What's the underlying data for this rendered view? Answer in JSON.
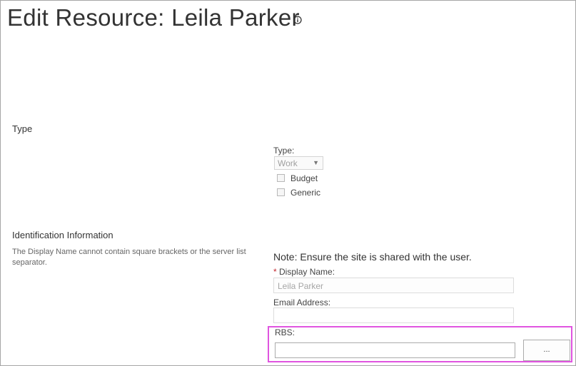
{
  "header": {
    "title": "Edit Resource: Leila Parker",
    "info_icon": "info-icon"
  },
  "sections": {
    "type": {
      "title": "Type",
      "type_label": "Type:",
      "type_value": "Work",
      "checkboxes": [
        {
          "label": "Budget",
          "checked": false
        },
        {
          "label": "Generic",
          "checked": false
        }
      ]
    },
    "identification": {
      "title": "Identification Information",
      "description": "The Display Name cannot contain square brackets or the server list separator.",
      "note": "Note: Ensure the site is shared with the user.",
      "required_marker": "*",
      "display_name_label": "Display Name:",
      "display_name_value": "Leila Parker",
      "email_label": "Email Address:",
      "email_value": "",
      "rbs_label": "RBS:",
      "rbs_value": "",
      "browse_label": "..."
    }
  },
  "colors": {
    "highlight": "#e055e0",
    "required": "#c4262e"
  }
}
